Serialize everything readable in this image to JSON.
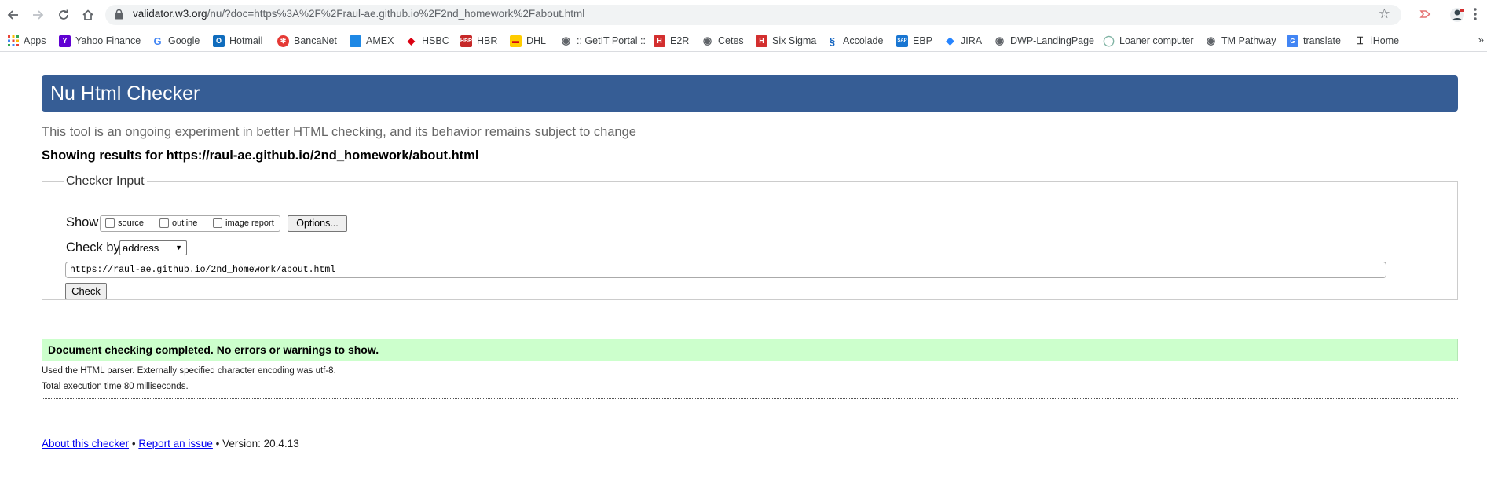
{
  "browser": {
    "url_host": "validator.w3.org",
    "url_path": "/nu/?doc=https%3A%2F%2Fraul-ae.github.io%2F2nd_homework%2Fabout.html",
    "bookmarks": [
      {
        "label": "Apps",
        "icon": "apps-grid-icon",
        "color": "#ea4335"
      },
      {
        "label": "Yahoo Finance",
        "icon": "yahoo-icon",
        "color": "#6001d2"
      },
      {
        "label": "Google",
        "icon": "google-icon",
        "color": "#4285f4"
      },
      {
        "label": "Hotmail",
        "icon": "outlook-icon",
        "color": "#0f6cbd"
      },
      {
        "label": "BancaNet",
        "icon": "banca-icon",
        "color": "#e53935"
      },
      {
        "label": "AMEX",
        "icon": "amex-icon",
        "color": "#1e88e5"
      },
      {
        "label": "HSBC",
        "icon": "hsbc-icon",
        "color": "#db0011"
      },
      {
        "label": "HBR",
        "icon": "hbr-icon",
        "color": "#c62828"
      },
      {
        "label": "DHL",
        "icon": "dhl-icon",
        "color": "#ffcc00"
      },
      {
        "label": ":: GetIT Portal ::",
        "icon": "globe-icon",
        "color": "#5f6368"
      },
      {
        "label": "E2R",
        "icon": "h-logo-icon",
        "color": "#d32f2f"
      },
      {
        "label": "Cetes",
        "icon": "globe-icon",
        "color": "#5f6368"
      },
      {
        "label": "Six Sigma",
        "icon": "h-logo-icon",
        "color": "#d32f2f"
      },
      {
        "label": "Accolade",
        "icon": "accolade-icon",
        "color": "#1565c0"
      },
      {
        "label": "EBP",
        "icon": "sap-icon",
        "color": "#1976d2"
      },
      {
        "label": "JIRA",
        "icon": "jira-icon",
        "color": "#2684ff"
      },
      {
        "label": "DWP-LandingPage",
        "icon": "globe-icon",
        "color": "#5f6368"
      },
      {
        "label": "Loaner computer",
        "icon": "person-icon",
        "color": "#7fb3a3"
      },
      {
        "label": "TM Pathway",
        "icon": "globe-icon",
        "color": "#5f6368"
      },
      {
        "label": "translate",
        "icon": "translate-icon",
        "color": "#4285f4"
      },
      {
        "label": "iHome",
        "icon": "ihome-icon",
        "color": "#222222"
      }
    ]
  },
  "page": {
    "title": "Nu Html Checker",
    "tagline": "This tool is an ongoing experiment in better HTML checking, and its behavior remains subject to change",
    "results_for": "Showing results for https://raul-ae.github.io/2nd_homework/about.html",
    "checker": {
      "legend": "Checker Input",
      "show_label": "Show",
      "show_options": [
        "source",
        "outline",
        "image report"
      ],
      "options_button": "Options...",
      "check_by_label": "Check by",
      "check_by_value": "address",
      "url_value": "https://raul-ae.github.io/2nd_homework/about.html",
      "check_button": "Check"
    },
    "result_message": "Document checking completed. No errors or warnings to show.",
    "notes": [
      "Used the HTML parser. Externally specified character encoding was utf-8.",
      "Total execution time 80 milliseconds."
    ],
    "footer": {
      "about_link": "About this checker",
      "separator": "•",
      "report_link": "Report an issue",
      "version": "• Version: 20.4.13"
    }
  },
  "colors": {
    "header_bg": "#365d95",
    "success_bg": "#ccffcc",
    "link": "#0000ee"
  }
}
